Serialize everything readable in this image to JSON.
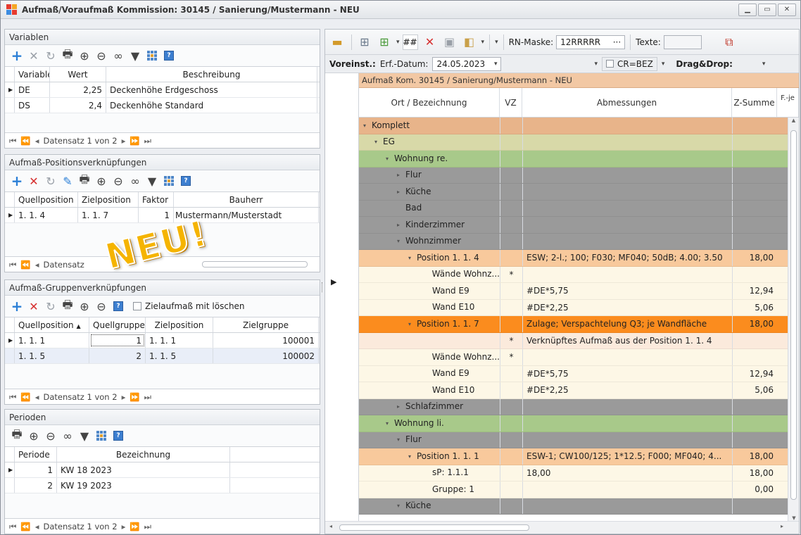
{
  "window": {
    "title": "Aufmaß/Voraufmaß Kommission: 30145 / Sanierung/Mustermann - NEU"
  },
  "variablen": {
    "title": "Variablen",
    "columns": [
      "Variable",
      "Wert",
      "Beschreibung"
    ],
    "rows": [
      {
        "variable": "DE",
        "wert": "2,25",
        "beschreibung": "Deckenhöhe Erdgeschoss"
      },
      {
        "variable": "DS",
        "wert": "2,4",
        "beschreibung": "Deckenhöhe Standard"
      }
    ],
    "nav": "Datensatz 1 von 2"
  },
  "positionsverk": {
    "title": "Aufmaß-Positionsverknüpfungen",
    "columns": [
      "Quellposition",
      "Zielposition",
      "Faktor",
      "Bauherr"
    ],
    "rows": [
      {
        "quell": "1. 1. 4",
        "ziel": "1. 1. 7",
        "faktor": "1",
        "bauherr": "Mustermann/Musterstadt"
      }
    ],
    "nav": "Datensatz"
  },
  "gruppenverk": {
    "title": "Aufmaß-Gruppenverknüpfungen",
    "checkbox_label": "Zielaufmaß mit löschen",
    "columns": [
      "Quellposition",
      "Quellgruppe",
      "Zielposition",
      "Zielgruppe"
    ],
    "rows": [
      {
        "quell": "1. 1. 1",
        "qgruppe": "1",
        "ziel": "1. 1. 1",
        "zgruppe": "100001"
      },
      {
        "quell": "1. 1. 5",
        "qgruppe": "2",
        "ziel": "1. 1. 5",
        "zgruppe": "100002"
      }
    ],
    "nav": "Datensatz 1 von 2"
  },
  "perioden": {
    "title": "Perioden",
    "columns": [
      "Periode",
      "Bezeichnung"
    ],
    "rows": [
      {
        "periode": "1",
        "bez": "KW 18 2023"
      },
      {
        "periode": "2",
        "bez": "KW 19 2023"
      }
    ],
    "nav": "Datensatz 1 von 2"
  },
  "badge": "NEU!",
  "toolbar": {
    "hash_label": "##",
    "rn_label": "RN-Maske:",
    "rn_value": "12RRRRR",
    "rn_more": "···",
    "texte_label": "Texte:",
    "voreinst": "Voreinst.:",
    "erf_label": "Erf.-Datum:",
    "erf_value": "24.05.2023",
    "cr_label": "CR=BEZ",
    "dragdrop": "Drag&Drop:"
  },
  "main": {
    "band": "Aufmaß Kom. 30145 / Sanierung/Mustermann - NEU",
    "columns": [
      "Ort / Bezeichnung",
      "VZ",
      "Abmessungen",
      "Z-Summe",
      "F.-je"
    ],
    "rows": [
      {
        "lvl": 0,
        "exp": "▾",
        "label": "Komplett",
        "vz": "",
        "abm": "",
        "sum": "",
        "bg": "#e8b48a"
      },
      {
        "lvl": 1,
        "exp": "▾",
        "label": "EG",
        "vz": "",
        "abm": "",
        "sum": "",
        "bg": "#d8d9a8"
      },
      {
        "lvl": 2,
        "exp": "▾",
        "label": "Wohnung re.",
        "vz": "",
        "abm": "",
        "sum": "",
        "bg": "#a8c98a"
      },
      {
        "lvl": 3,
        "exp": "▸",
        "label": "Flur",
        "vz": "",
        "abm": "",
        "sum": "",
        "bg": "#9a9a9a"
      },
      {
        "lvl": 3,
        "exp": "▸",
        "label": "Küche",
        "vz": "",
        "abm": "",
        "sum": "",
        "bg": "#9a9a9a"
      },
      {
        "lvl": 3,
        "exp": "",
        "label": "Bad",
        "vz": "",
        "abm": "",
        "sum": "",
        "bg": "#9a9a9a"
      },
      {
        "lvl": 3,
        "exp": "▸",
        "label": "Kinderzimmer",
        "vz": "",
        "abm": "",
        "sum": "",
        "bg": "#9a9a9a"
      },
      {
        "lvl": 3,
        "exp": "▾",
        "label": "Wohnzimmer",
        "vz": "",
        "abm": "",
        "sum": "",
        "bg": "#9a9a9a"
      },
      {
        "lvl": 4,
        "exp": "▾",
        "label": "Position  1. 1.  4",
        "vz": "",
        "abm": "ESW; 2-l.; 100; F030; MF040; 50dB; 4.00; 3.50",
        "sum": "18,00",
        "bg": "#f8c99c"
      },
      {
        "lvl": 5,
        "exp": "",
        "label": "Wände Wohnz...",
        "vz": "*",
        "abm": "",
        "sum": "",
        "bg": "#fdf7e6"
      },
      {
        "lvl": 5,
        "exp": "",
        "label": "Wand E9",
        "vz": "",
        "abm": "#DE*5,75",
        "sum": "12,94",
        "bg": "#fdf7e6"
      },
      {
        "lvl": 5,
        "exp": "",
        "label": "Wand E10",
        "vz": "",
        "abm": "#DE*2,25",
        "sum": "5,06",
        "bg": "#fdf7e6"
      },
      {
        "lvl": 4,
        "exp": "▾",
        "label": "Position  1. 1.  7",
        "vz": "",
        "abm": "Zulage; Verspachtelung Q3; je Wandfläche",
        "sum": "18,00",
        "bg": "#fb8c1e"
      },
      {
        "lvl": 5,
        "exp": "",
        "label": "",
        "vz": "*",
        "abm": "Verknüpftes Aufmaß aus der Position  1. 1.  4",
        "sum": "",
        "bg": "#fbeadc"
      },
      {
        "lvl": 5,
        "exp": "",
        "label": "Wände Wohnz...",
        "vz": "*",
        "abm": "",
        "sum": "",
        "bg": "#fdf7e6"
      },
      {
        "lvl": 5,
        "exp": "",
        "label": "Wand E9",
        "vz": "",
        "abm": "#DE*5,75",
        "sum": "12,94",
        "bg": "#fdf7e6"
      },
      {
        "lvl": 5,
        "exp": "",
        "label": "Wand E10",
        "vz": "",
        "abm": "#DE*2,25",
        "sum": "5,06",
        "bg": "#fdf7e6"
      },
      {
        "lvl": 3,
        "exp": "▸",
        "label": "Schlafzimmer",
        "vz": "",
        "abm": "",
        "sum": "",
        "bg": "#9a9a9a"
      },
      {
        "lvl": 2,
        "exp": "▾",
        "label": "Wohnung li.",
        "vz": "",
        "abm": "",
        "sum": "",
        "bg": "#a8c98a"
      },
      {
        "lvl": 3,
        "exp": "▾",
        "label": "Flur",
        "vz": "",
        "abm": "",
        "sum": "",
        "bg": "#9a9a9a"
      },
      {
        "lvl": 4,
        "exp": "▾",
        "label": "Position  1. 1.  1",
        "vz": "",
        "abm": "ESW-1; CW100/125; 1*12.5; F000; MF040; 4...",
        "sum": "18,00",
        "bg": "#f8c99c"
      },
      {
        "lvl": 5,
        "exp": "",
        "label": "sP: 1.1.1",
        "vz": "",
        "abm": "18,00",
        "sum": "18,00",
        "bg": "#fdf7e6"
      },
      {
        "lvl": 5,
        "exp": "",
        "label": "Gruppe:     1",
        "vz": "",
        "abm": "",
        "sum": "0,00",
        "bg": "#fdf7e6"
      },
      {
        "lvl": 3,
        "exp": "▾",
        "label": "Küche",
        "vz": "",
        "abm": "",
        "sum": "",
        "bg": "#9a9a9a"
      }
    ]
  },
  "colors": {
    "accent": "#2b7fd6",
    "delete": "#d62f2f",
    "badge": "#f5b400"
  }
}
